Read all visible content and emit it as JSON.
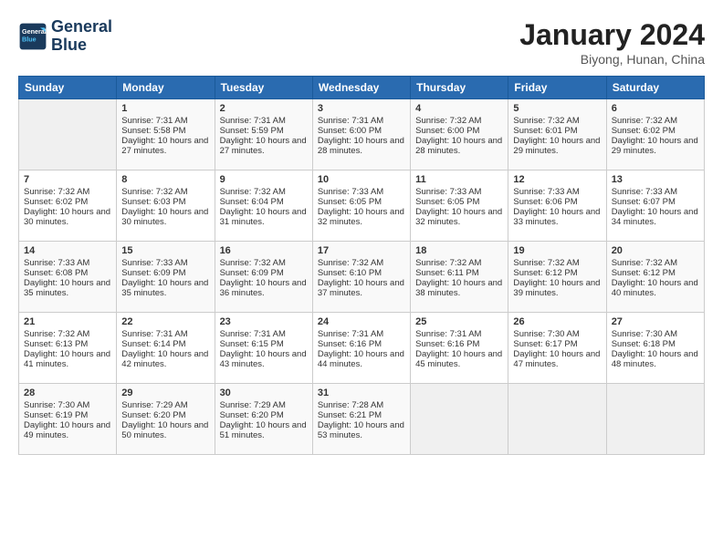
{
  "header": {
    "logo_line1": "General",
    "logo_line2": "Blue",
    "main_title": "January 2024",
    "subtitle": "Biyong, Hunan, China"
  },
  "calendar": {
    "days_of_week": [
      "Sunday",
      "Monday",
      "Tuesday",
      "Wednesday",
      "Thursday",
      "Friday",
      "Saturday"
    ],
    "weeks": [
      [
        {
          "num": "",
          "sunrise": "",
          "sunset": "",
          "daylight": "",
          "empty": true
        },
        {
          "num": "1",
          "sunrise": "Sunrise: 7:31 AM",
          "sunset": "Sunset: 5:58 PM",
          "daylight": "Daylight: 10 hours and 27 minutes."
        },
        {
          "num": "2",
          "sunrise": "Sunrise: 7:31 AM",
          "sunset": "Sunset: 5:59 PM",
          "daylight": "Daylight: 10 hours and 27 minutes."
        },
        {
          "num": "3",
          "sunrise": "Sunrise: 7:31 AM",
          "sunset": "Sunset: 6:00 PM",
          "daylight": "Daylight: 10 hours and 28 minutes."
        },
        {
          "num": "4",
          "sunrise": "Sunrise: 7:32 AM",
          "sunset": "Sunset: 6:00 PM",
          "daylight": "Daylight: 10 hours and 28 minutes."
        },
        {
          "num": "5",
          "sunrise": "Sunrise: 7:32 AM",
          "sunset": "Sunset: 6:01 PM",
          "daylight": "Daylight: 10 hours and 29 minutes."
        },
        {
          "num": "6",
          "sunrise": "Sunrise: 7:32 AM",
          "sunset": "Sunset: 6:02 PM",
          "daylight": "Daylight: 10 hours and 29 minutes."
        }
      ],
      [
        {
          "num": "7",
          "sunrise": "Sunrise: 7:32 AM",
          "sunset": "Sunset: 6:02 PM",
          "daylight": "Daylight: 10 hours and 30 minutes."
        },
        {
          "num": "8",
          "sunrise": "Sunrise: 7:32 AM",
          "sunset": "Sunset: 6:03 PM",
          "daylight": "Daylight: 10 hours and 30 minutes."
        },
        {
          "num": "9",
          "sunrise": "Sunrise: 7:32 AM",
          "sunset": "Sunset: 6:04 PM",
          "daylight": "Daylight: 10 hours and 31 minutes."
        },
        {
          "num": "10",
          "sunrise": "Sunrise: 7:33 AM",
          "sunset": "Sunset: 6:05 PM",
          "daylight": "Daylight: 10 hours and 32 minutes."
        },
        {
          "num": "11",
          "sunrise": "Sunrise: 7:33 AM",
          "sunset": "Sunset: 6:05 PM",
          "daylight": "Daylight: 10 hours and 32 minutes."
        },
        {
          "num": "12",
          "sunrise": "Sunrise: 7:33 AM",
          "sunset": "Sunset: 6:06 PM",
          "daylight": "Daylight: 10 hours and 33 minutes."
        },
        {
          "num": "13",
          "sunrise": "Sunrise: 7:33 AM",
          "sunset": "Sunset: 6:07 PM",
          "daylight": "Daylight: 10 hours and 34 minutes."
        }
      ],
      [
        {
          "num": "14",
          "sunrise": "Sunrise: 7:33 AM",
          "sunset": "Sunset: 6:08 PM",
          "daylight": "Daylight: 10 hours and 35 minutes."
        },
        {
          "num": "15",
          "sunrise": "Sunrise: 7:33 AM",
          "sunset": "Sunset: 6:09 PM",
          "daylight": "Daylight: 10 hours and 35 minutes."
        },
        {
          "num": "16",
          "sunrise": "Sunrise: 7:32 AM",
          "sunset": "Sunset: 6:09 PM",
          "daylight": "Daylight: 10 hours and 36 minutes."
        },
        {
          "num": "17",
          "sunrise": "Sunrise: 7:32 AM",
          "sunset": "Sunset: 6:10 PM",
          "daylight": "Daylight: 10 hours and 37 minutes."
        },
        {
          "num": "18",
          "sunrise": "Sunrise: 7:32 AM",
          "sunset": "Sunset: 6:11 PM",
          "daylight": "Daylight: 10 hours and 38 minutes."
        },
        {
          "num": "19",
          "sunrise": "Sunrise: 7:32 AM",
          "sunset": "Sunset: 6:12 PM",
          "daylight": "Daylight: 10 hours and 39 minutes."
        },
        {
          "num": "20",
          "sunrise": "Sunrise: 7:32 AM",
          "sunset": "Sunset: 6:12 PM",
          "daylight": "Daylight: 10 hours and 40 minutes."
        }
      ],
      [
        {
          "num": "21",
          "sunrise": "Sunrise: 7:32 AM",
          "sunset": "Sunset: 6:13 PM",
          "daylight": "Daylight: 10 hours and 41 minutes."
        },
        {
          "num": "22",
          "sunrise": "Sunrise: 7:31 AM",
          "sunset": "Sunset: 6:14 PM",
          "daylight": "Daylight: 10 hours and 42 minutes."
        },
        {
          "num": "23",
          "sunrise": "Sunrise: 7:31 AM",
          "sunset": "Sunset: 6:15 PM",
          "daylight": "Daylight: 10 hours and 43 minutes."
        },
        {
          "num": "24",
          "sunrise": "Sunrise: 7:31 AM",
          "sunset": "Sunset: 6:16 PM",
          "daylight": "Daylight: 10 hours and 44 minutes."
        },
        {
          "num": "25",
          "sunrise": "Sunrise: 7:31 AM",
          "sunset": "Sunset: 6:16 PM",
          "daylight": "Daylight: 10 hours and 45 minutes."
        },
        {
          "num": "26",
          "sunrise": "Sunrise: 7:30 AM",
          "sunset": "Sunset: 6:17 PM",
          "daylight": "Daylight: 10 hours and 47 minutes."
        },
        {
          "num": "27",
          "sunrise": "Sunrise: 7:30 AM",
          "sunset": "Sunset: 6:18 PM",
          "daylight": "Daylight: 10 hours and 48 minutes."
        }
      ],
      [
        {
          "num": "28",
          "sunrise": "Sunrise: 7:30 AM",
          "sunset": "Sunset: 6:19 PM",
          "daylight": "Daylight: 10 hours and 49 minutes."
        },
        {
          "num": "29",
          "sunrise": "Sunrise: 7:29 AM",
          "sunset": "Sunset: 6:20 PM",
          "daylight": "Daylight: 10 hours and 50 minutes."
        },
        {
          "num": "30",
          "sunrise": "Sunrise: 7:29 AM",
          "sunset": "Sunset: 6:20 PM",
          "daylight": "Daylight: 10 hours and 51 minutes."
        },
        {
          "num": "31",
          "sunrise": "Sunrise: 7:28 AM",
          "sunset": "Sunset: 6:21 PM",
          "daylight": "Daylight: 10 hours and 53 minutes."
        },
        {
          "num": "",
          "sunrise": "",
          "sunset": "",
          "daylight": "",
          "empty": true
        },
        {
          "num": "",
          "sunrise": "",
          "sunset": "",
          "daylight": "",
          "empty": true
        },
        {
          "num": "",
          "sunrise": "",
          "sunset": "",
          "daylight": "",
          "empty": true
        }
      ]
    ]
  }
}
